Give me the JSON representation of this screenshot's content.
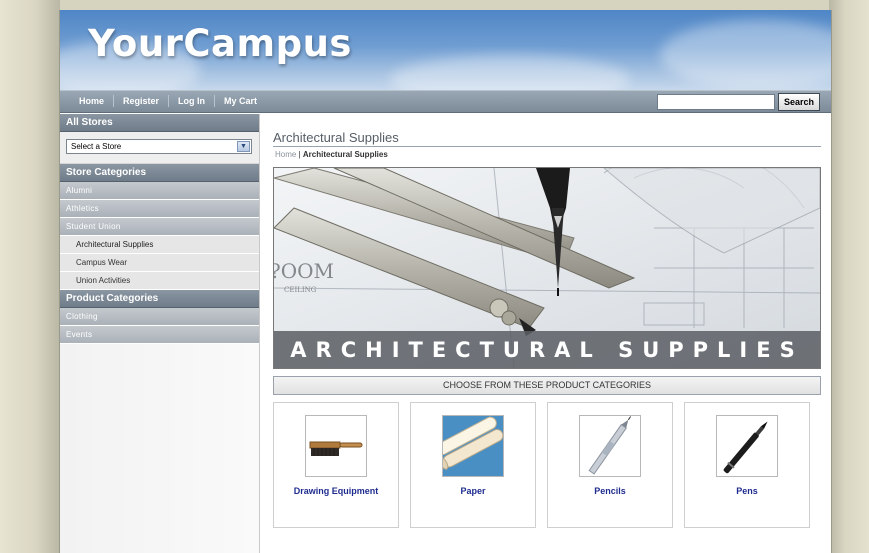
{
  "site": {
    "logo": "YourCampus"
  },
  "nav": {
    "links": [
      "Home",
      "Register",
      "Log In",
      "My Cart"
    ],
    "search_button": "Search",
    "search_value": ""
  },
  "sidebar": {
    "all_stores_heading": "All Stores",
    "store_select_value": "Select a Store",
    "store_categories_heading": "Store Categories",
    "store_categories": [
      "Alumni",
      "Athletics",
      "Student Union"
    ],
    "student_union_sub": [
      "Architectural Supplies",
      "Campus Wear",
      "Union Activities"
    ],
    "product_categories_heading": "Product Categories",
    "product_categories": [
      "Clothing",
      "Events"
    ]
  },
  "main": {
    "title": "Architectural Supplies",
    "breadcrumb": {
      "home": "Home",
      "separator": "|",
      "current": "Architectural Supplies"
    },
    "banner_caption": "ARCHITECTURAL SUPPLIES",
    "choose_heading": "CHOOSE FROM THESE PRODUCT CATEGORIES",
    "products": [
      {
        "name": "Drawing Equipment",
        "icon": "brush-icon"
      },
      {
        "name": "Paper",
        "icon": "paper-roll-icon"
      },
      {
        "name": "Pencils",
        "icon": "pencil-icon"
      },
      {
        "name": "Pens",
        "icon": "pen-icon"
      }
    ]
  },
  "colors": {
    "nav_bar": "#7d8b99",
    "sidebar_heading": "#6f7c89",
    "product_link": "#1f2c8f",
    "header_sky": "#6f9dd2"
  }
}
